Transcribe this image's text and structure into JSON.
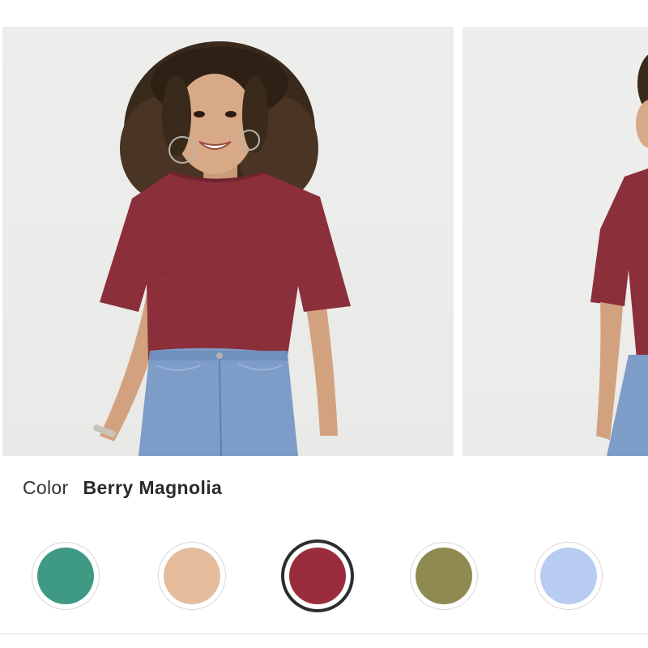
{
  "product": {
    "color_label": "Color",
    "selected_color": "Berry Magnolia"
  },
  "gallery": {
    "images": [
      {
        "name": "model-front-photo",
        "shirt_color": "#8b2f3a",
        "jeans_color": "#7d9cc7"
      },
      {
        "name": "model-side-photo",
        "shirt_color": "#8b2f3a",
        "jeans_color": "#7d9cc7"
      }
    ]
  },
  "swatches": [
    {
      "color": "#3f9a84",
      "selected": false
    },
    {
      "color": "#e6bd9c",
      "selected": false
    },
    {
      "color": "#9a2d3d",
      "selected": true
    },
    {
      "color": "#8f8a52",
      "selected": false
    },
    {
      "color": "#b8ccf1",
      "selected": false
    }
  ]
}
